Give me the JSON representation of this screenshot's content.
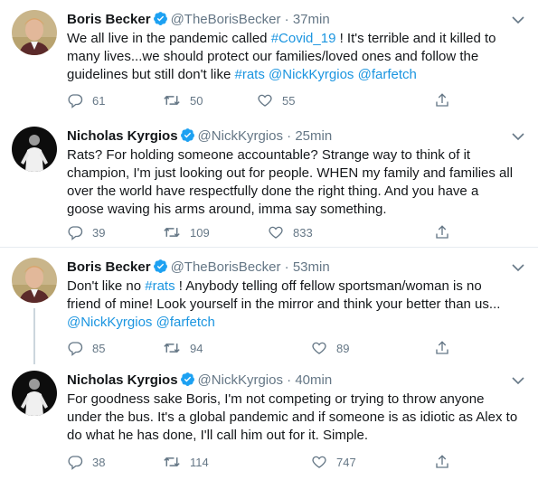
{
  "tweets": [
    {
      "name": "Boris Becker",
      "handle": "@TheBorisBecker",
      "dot": "·",
      "time": "37min",
      "segments": [
        {
          "t": "We all live in the pandemic called "
        },
        {
          "t": "#Covid_19",
          "link": true
        },
        {
          "t": " ! It's terrible and it killed to many lives...we should protect our families/loved ones and follow the guidelines but still don't like "
        },
        {
          "t": "#rats",
          "link": true
        },
        {
          "t": " "
        },
        {
          "t": "@NickKyrgios",
          "link": true
        },
        {
          "t": " "
        },
        {
          "t": "@farfetch",
          "link": true
        }
      ],
      "replies": "61",
      "retweets": "50",
      "likes": "55"
    },
    {
      "name": "Nicholas Kyrgios",
      "handle": "@NickKyrgios",
      "dot": "·",
      "time": "25min",
      "segments": [
        {
          "t": "Rats? For holding someone accountable? Strange way to think of it champion, I'm just looking out for people. WHEN my family and families all over the world have respectfully done the right thing. And you have a goose waving his arms around, imma say something."
        }
      ],
      "replies": "39",
      "retweets": "109",
      "likes": "833"
    },
    {
      "name": "Boris Becker",
      "handle": "@TheBorisBecker",
      "dot": "·",
      "time": "53min",
      "segments": [
        {
          "t": "Don't like no "
        },
        {
          "t": "#rats",
          "link": true
        },
        {
          "t": " ! Anybody telling off fellow sportsman/woman is no friend of mine! Look yourself in the mirror and think your better than us... "
        },
        {
          "t": "@NickKyrgios",
          "link": true
        },
        {
          "t": " "
        },
        {
          "t": "@farfetch",
          "link": true
        }
      ],
      "replies": "85",
      "retweets": "94",
      "likes": "89"
    },
    {
      "name": "Nicholas Kyrgios",
      "handle": "@NickKyrgios",
      "dot": "·",
      "time": "40min",
      "segments": [
        {
          "t": "For goodness sake Boris, I'm not competing or trying to throw anyone under the bus. It's a global pandemic and if someone is as idiotic as Alex to do what he has done, I'll call him out for it. Simple."
        }
      ],
      "replies": "38",
      "retweets": "114",
      "likes": "747"
    }
  ],
  "icons": {
    "verified": "verified-badge-icon",
    "caret": "chevron-down-icon",
    "reply": "reply-icon",
    "retweet": "retweet-icon",
    "like": "heart-icon",
    "share": "share-icon"
  },
  "colors": {
    "link": "#1b95e0",
    "verified": "#1da1f2",
    "muted": "#657786",
    "divider": "#e6ecf0"
  }
}
